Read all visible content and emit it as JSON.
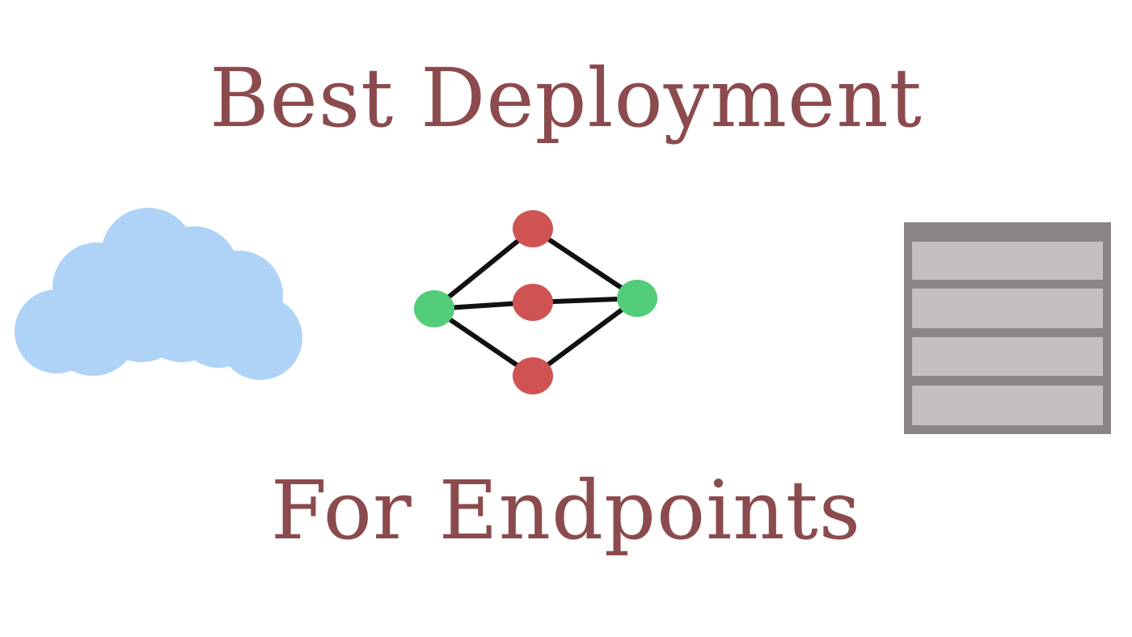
{
  "heading": {
    "line1": "Best Deployment",
    "line2": "For Endpoints"
  },
  "illustrations": {
    "cloud": "cloud-icon",
    "network": "network-graph-icon",
    "server": "server-rack-icon"
  },
  "colors": {
    "text": "#8b4b4e",
    "cloud": "#aed3f7",
    "node_red": "#d05353",
    "node_green": "#52cc78",
    "edge": "#111111",
    "server_frame": "#8b8585",
    "server_drive": "#c4c0c0"
  }
}
